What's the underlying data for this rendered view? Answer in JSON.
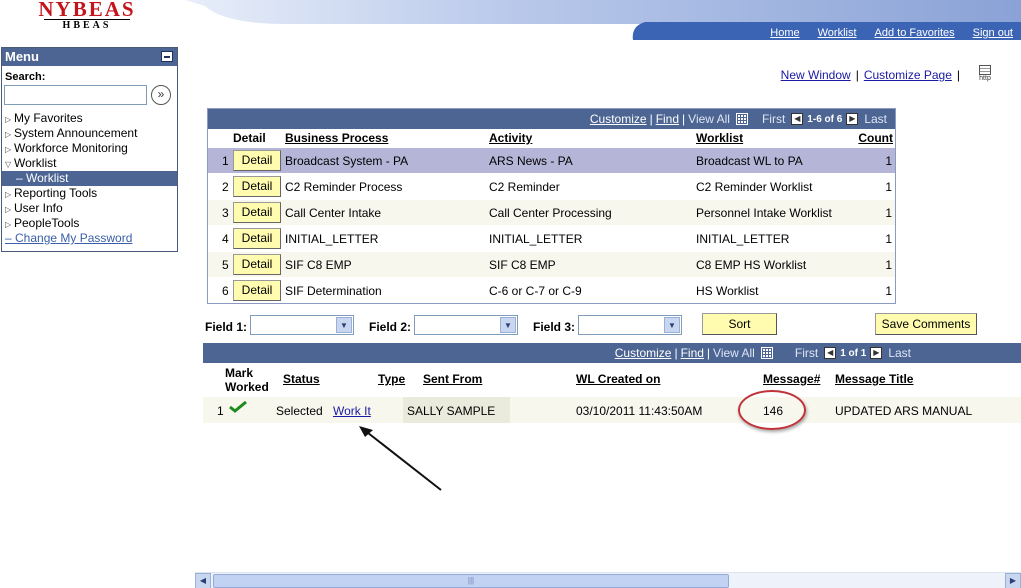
{
  "logo": {
    "main": "NYBEAS",
    "sub": "HBEAS"
  },
  "topnav": [
    "Home",
    "Worklist",
    "Add to Favorites",
    "Sign out"
  ],
  "menu": {
    "title": "Menu",
    "search_label": "Search:",
    "search_value": "",
    "items": [
      {
        "label": "My Favorites",
        "state": "collapsed"
      },
      {
        "label": "System Announcement",
        "state": "collapsed"
      },
      {
        "label": "Workforce Monitoring",
        "state": "collapsed"
      },
      {
        "label": "Worklist",
        "state": "expanded"
      },
      {
        "label": "Worklist",
        "state": "selected-child"
      },
      {
        "label": "Reporting Tools",
        "state": "collapsed"
      },
      {
        "label": "User Info",
        "state": "collapsed"
      },
      {
        "label": "PeopleTools",
        "state": "collapsed"
      },
      {
        "label": "Change My Password",
        "state": "link"
      }
    ]
  },
  "pagelinks": {
    "new_window": "New Window",
    "customize_page": "Customize Page",
    "http_icon_text": "http"
  },
  "grid1": {
    "toolbar": {
      "customize": "Customize",
      "find": "Find",
      "view_all": "View All",
      "first": "First",
      "range": "1-6 of 6",
      "last": "Last"
    },
    "headers": {
      "detail": "Detail",
      "business_process": "Business Process",
      "activity": "Activity",
      "worklist": "Worklist",
      "count": "Count"
    },
    "rows": [
      {
        "n": "1",
        "btn": "Detail",
        "bp": "Broadcast System - PA",
        "activity": "ARS News - PA",
        "worklist": "Broadcast WL to PA",
        "count": "1"
      },
      {
        "n": "2",
        "btn": "Detail",
        "bp": "C2 Reminder Process",
        "activity": "C2 Reminder",
        "worklist": "C2 Reminder Worklist",
        "count": "1"
      },
      {
        "n": "3",
        "btn": "Detail",
        "bp": "Call Center Intake",
        "activity": "Call Center Processing",
        "worklist": "Personnel Intake Worklist",
        "count": "1"
      },
      {
        "n": "4",
        "btn": "Detail",
        "bp": "INITIAL_LETTER",
        "activity": "INITIAL_LETTER",
        "worklist": "INITIAL_LETTER",
        "count": "1"
      },
      {
        "n": "5",
        "btn": "Detail",
        "bp": "SIF C8 EMP",
        "activity": "SIF C8 EMP",
        "worklist": "C8 EMP HS Worklist",
        "count": "1"
      },
      {
        "n": "6",
        "btn": "Detail",
        "bp": "SIF Determination",
        "activity": "C-6 or C-7 or C-9",
        "worklist": "HS Worklist",
        "count": "1"
      }
    ]
  },
  "fields": {
    "field1": "Field 1:",
    "field2": "Field 2:",
    "field3": "Field 3:",
    "sort": "Sort",
    "save_comments": "Save Comments"
  },
  "grid2": {
    "toolbar": {
      "customize": "Customize",
      "find": "Find",
      "view_all": "View All",
      "first": "First",
      "range": "1 of 1",
      "last": "Last"
    },
    "headers": {
      "mark_worked": "Mark Worked",
      "status": "Status",
      "type": "Type",
      "sent_from": "Sent From",
      "wl_created": "WL Created on",
      "message_num": "Message#",
      "message_title": "Message Title"
    },
    "row": {
      "n": "1",
      "status": "Selected",
      "work_it": "Work It",
      "sent_from": "SALLY SAMPLE",
      "created": "03/10/2011 11:43:50AM",
      "message_num": "146",
      "message_title": "UPDATED ARS  MANUAL"
    }
  },
  "colors": {
    "brand_red": "#c4151c",
    "header_blue": "#4d6593",
    "button_yellow": "#fffcb0",
    "highlight_ring": "#c0323a"
  }
}
